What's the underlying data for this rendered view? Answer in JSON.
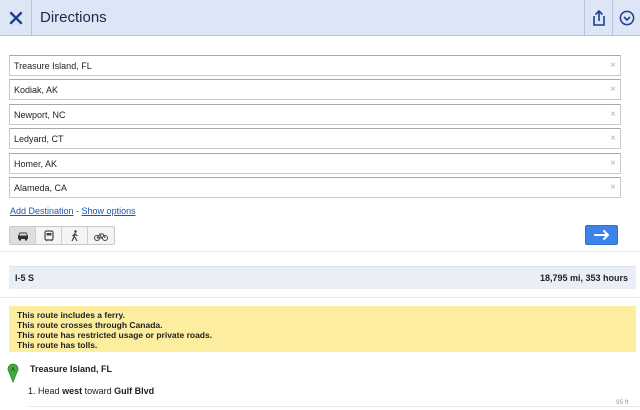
{
  "header": {
    "title": "Directions"
  },
  "destinations": [
    {
      "value": "Treasure Island, FL"
    },
    {
      "value": "Kodiak, AK"
    },
    {
      "value": "Newport, NC"
    },
    {
      "value": "Ledyard, CT"
    },
    {
      "value": "Homer, AK"
    },
    {
      "value": "Alameda, CA"
    }
  ],
  "clear_glyph": "×",
  "links": {
    "add_destination": "Add Destination",
    "separator": " - ",
    "show_options": "Show options"
  },
  "modes": [
    {
      "icon": "car-icon",
      "active": true
    },
    {
      "icon": "transit-icon",
      "active": false
    },
    {
      "icon": "walking-icon",
      "active": false
    },
    {
      "icon": "bicycle-icon",
      "active": false
    }
  ],
  "route": {
    "name": "I-5 S",
    "distance_time": "18,795 mi, 353 hours"
  },
  "warnings": [
    "This route includes a ferry.",
    "This route crosses through Canada.",
    "This route has restricted usage or private roads.",
    "This route has tolls."
  ],
  "start": {
    "marker_letter": "A",
    "name": "Treasure Island, FL"
  },
  "steps": [
    {
      "num": "1.",
      "pre": "Head ",
      "dir": "west",
      "mid": " toward ",
      "road": "Gulf Blvd",
      "distance": "95 ft"
    }
  ],
  "colors": {
    "header_bg": "#dde6f7",
    "accent_blue": "#3d84ea",
    "warning_bg": "#fdee9f",
    "marker_green": "#3fae3f"
  }
}
